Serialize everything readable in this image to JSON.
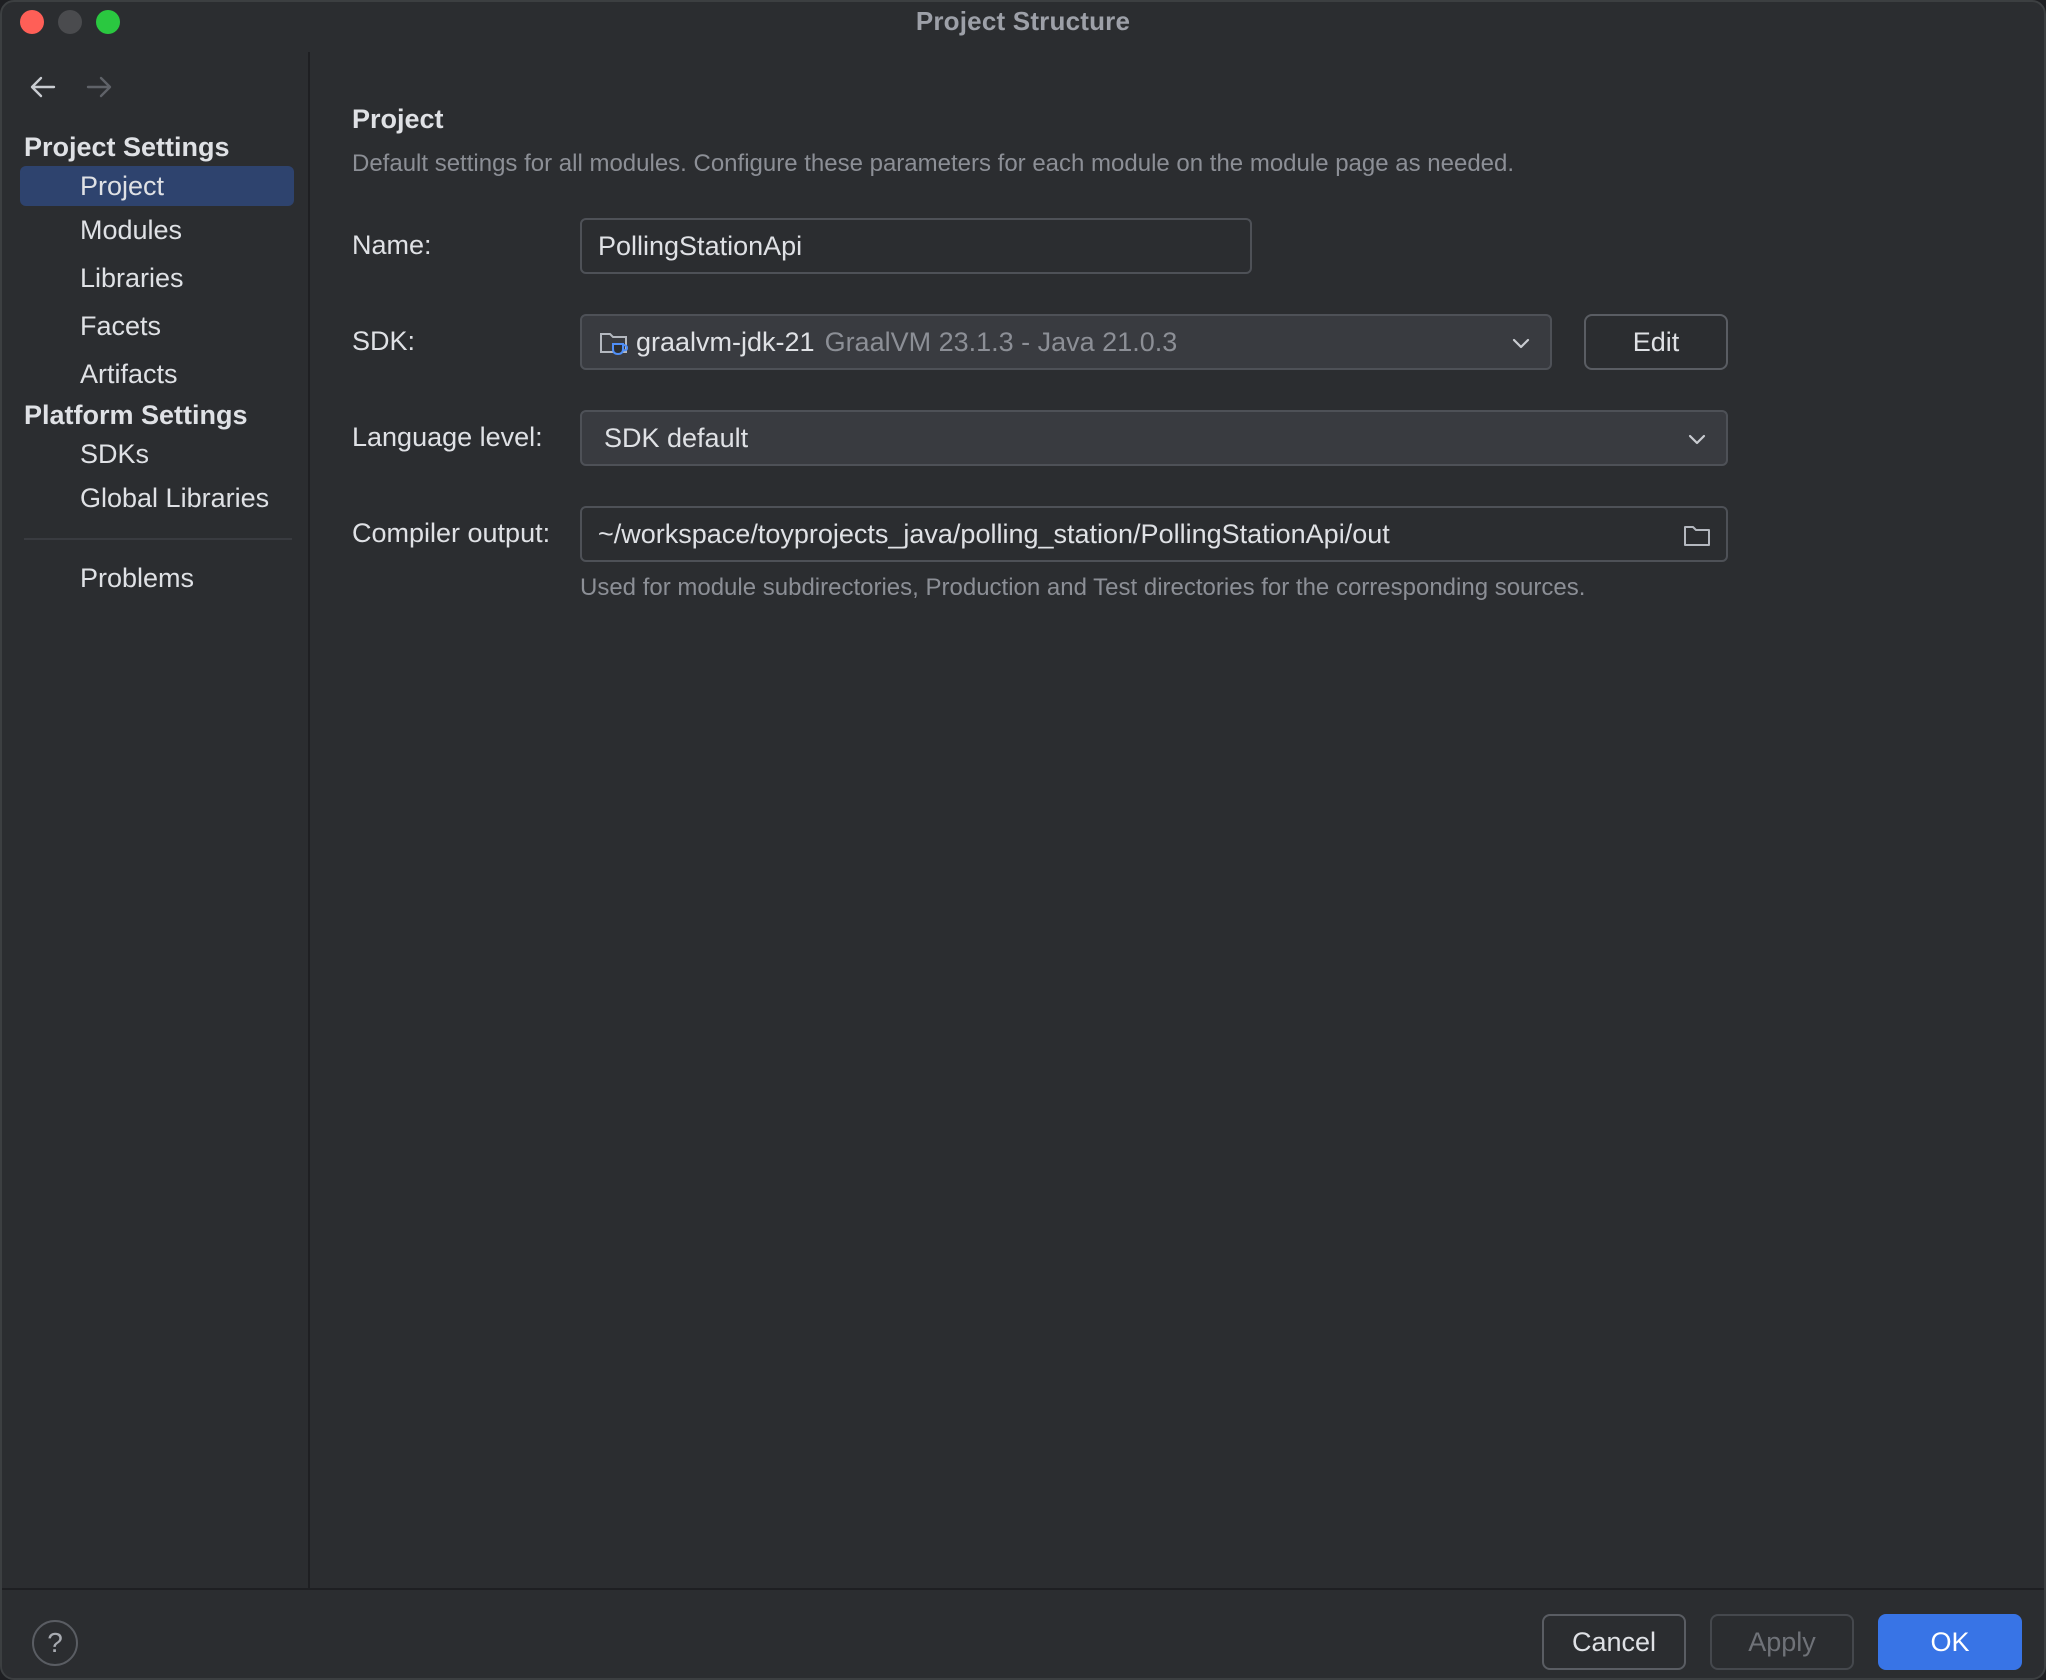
{
  "window": {
    "title": "Project Structure"
  },
  "nav": {
    "back_icon": "arrow-left-icon",
    "forward_icon": "arrow-right-icon"
  },
  "sidebar": {
    "project_settings_label": "Project Settings",
    "project_items": [
      {
        "label": "Project",
        "selected": true
      },
      {
        "label": "Modules"
      },
      {
        "label": "Libraries"
      },
      {
        "label": "Facets"
      },
      {
        "label": "Artifacts"
      }
    ],
    "platform_settings_label": "Platform Settings",
    "platform_items": [
      {
        "label": "SDKs"
      },
      {
        "label": "Global Libraries"
      }
    ],
    "problems_label": "Problems"
  },
  "main": {
    "title": "Project",
    "description": "Default settings for all modules. Configure these parameters for each module on the module page as needed.",
    "name_label": "Name:",
    "name_value": "PollingStationApi",
    "sdk_label": "SDK:",
    "sdk_name": "graalvm-jdk-21",
    "sdk_version": "GraalVM 23.1.3 - Java 21.0.3",
    "sdk_edit": "Edit",
    "language_level_label": "Language level:",
    "language_level_value": "SDK default",
    "compiler_output_label": "Compiler output:",
    "compiler_output_value": "~/workspace/toyprojects_java/polling_station/PollingStationApi/out",
    "compiler_output_hint": "Used for module subdirectories, Production and Test directories for the corresponding sources."
  },
  "footer": {
    "help": "?",
    "cancel": "Cancel",
    "apply": "Apply",
    "ok": "OK"
  },
  "colors": {
    "accent": "#3874e6",
    "selection": "#2e436e",
    "background": "#2b2d30"
  }
}
